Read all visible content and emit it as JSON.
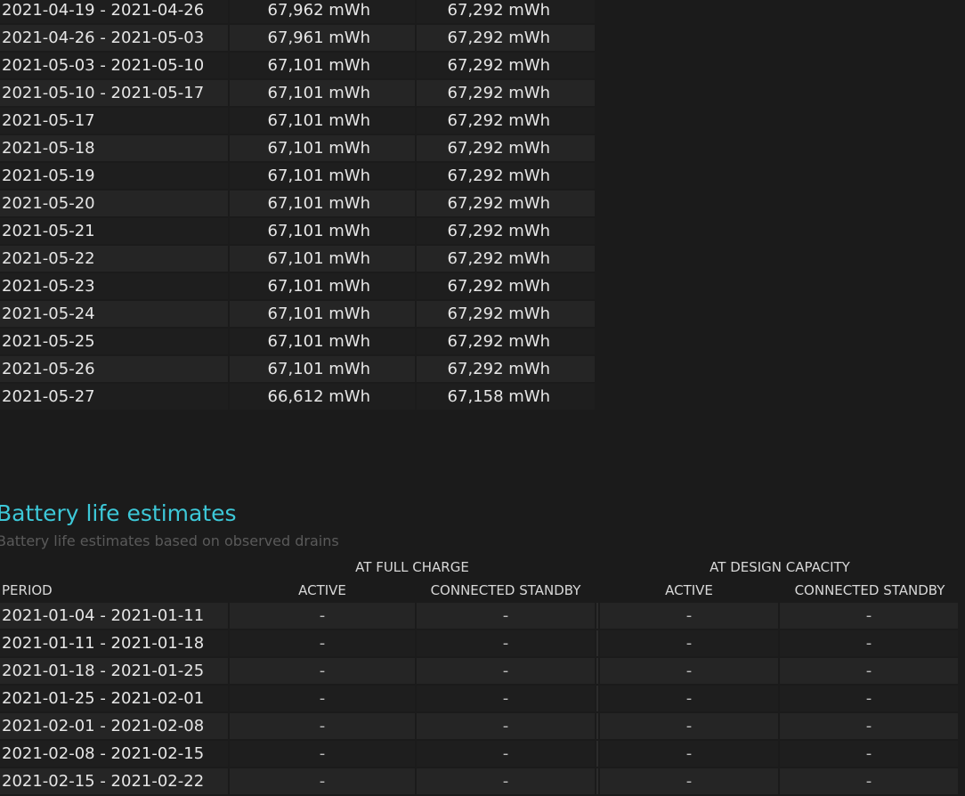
{
  "capacity_rows": [
    {
      "period": "2021-04-19 - 2021-04-26",
      "full": "67,962 mWh",
      "design": "67,292 mWh"
    },
    {
      "period": "2021-04-26 - 2021-05-03",
      "full": "67,961 mWh",
      "design": "67,292 mWh"
    },
    {
      "period": "2021-05-03 - 2021-05-10",
      "full": "67,101 mWh",
      "design": "67,292 mWh"
    },
    {
      "period": "2021-05-10 - 2021-05-17",
      "full": "67,101 mWh",
      "design": "67,292 mWh"
    },
    {
      "period": "2021-05-17",
      "full": "67,101 mWh",
      "design": "67,292 mWh"
    },
    {
      "period": "2021-05-18",
      "full": "67,101 mWh",
      "design": "67,292 mWh"
    },
    {
      "period": "2021-05-19",
      "full": "67,101 mWh",
      "design": "67,292 mWh"
    },
    {
      "period": "2021-05-20",
      "full": "67,101 mWh",
      "design": "67,292 mWh"
    },
    {
      "period": "2021-05-21",
      "full": "67,101 mWh",
      "design": "67,292 mWh"
    },
    {
      "period": "2021-05-22",
      "full": "67,101 mWh",
      "design": "67,292 mWh"
    },
    {
      "period": "2021-05-23",
      "full": "67,101 mWh",
      "design": "67,292 mWh"
    },
    {
      "period": "2021-05-24",
      "full": "67,101 mWh",
      "design": "67,292 mWh"
    },
    {
      "period": "2021-05-25",
      "full": "67,101 mWh",
      "design": "67,292 mWh"
    },
    {
      "period": "2021-05-26",
      "full": "67,101 mWh",
      "design": "67,292 mWh"
    },
    {
      "period": "2021-05-27",
      "full": "66,612 mWh",
      "design": "67,158 mWh"
    }
  ],
  "estimates": {
    "title": "Battery life estimates",
    "subtitle": "Battery life estimates based on observed drains",
    "group_full": "AT FULL CHARGE",
    "group_design": "AT DESIGN CAPACITY",
    "col_period": "PERIOD",
    "col_active": "ACTIVE",
    "col_standby": "CONNECTED STANDBY",
    "rows": [
      {
        "period": "2021-01-04 - 2021-01-11",
        "full_active": "-",
        "full_standby": "-",
        "design_active": "-",
        "design_standby": "-"
      },
      {
        "period": "2021-01-11 - 2021-01-18",
        "full_active": "-",
        "full_standby": "-",
        "design_active": "-",
        "design_standby": "-"
      },
      {
        "period": "2021-01-18 - 2021-01-25",
        "full_active": "-",
        "full_standby": "-",
        "design_active": "-",
        "design_standby": "-"
      },
      {
        "period": "2021-01-25 - 2021-02-01",
        "full_active": "-",
        "full_standby": "-",
        "design_active": "-",
        "design_standby": "-"
      },
      {
        "period": "2021-02-01 - 2021-02-08",
        "full_active": "-",
        "full_standby": "-",
        "design_active": "-",
        "design_standby": "-"
      },
      {
        "period": "2021-02-08 - 2021-02-15",
        "full_active": "-",
        "full_standby": "-",
        "design_active": "-",
        "design_standby": "-"
      },
      {
        "period": "2021-02-15 - 2021-02-22",
        "full_active": "-",
        "full_standby": "-",
        "design_active": "-",
        "design_standby": "-"
      }
    ]
  },
  "colors": {
    "background": "#1b1b1b",
    "row_even": "#252525",
    "row_odd": "#1e1e1e",
    "heading_accent": "#3dc8d8",
    "subtitle": "#5a5a5a",
    "text": "#e6e6e6"
  }
}
